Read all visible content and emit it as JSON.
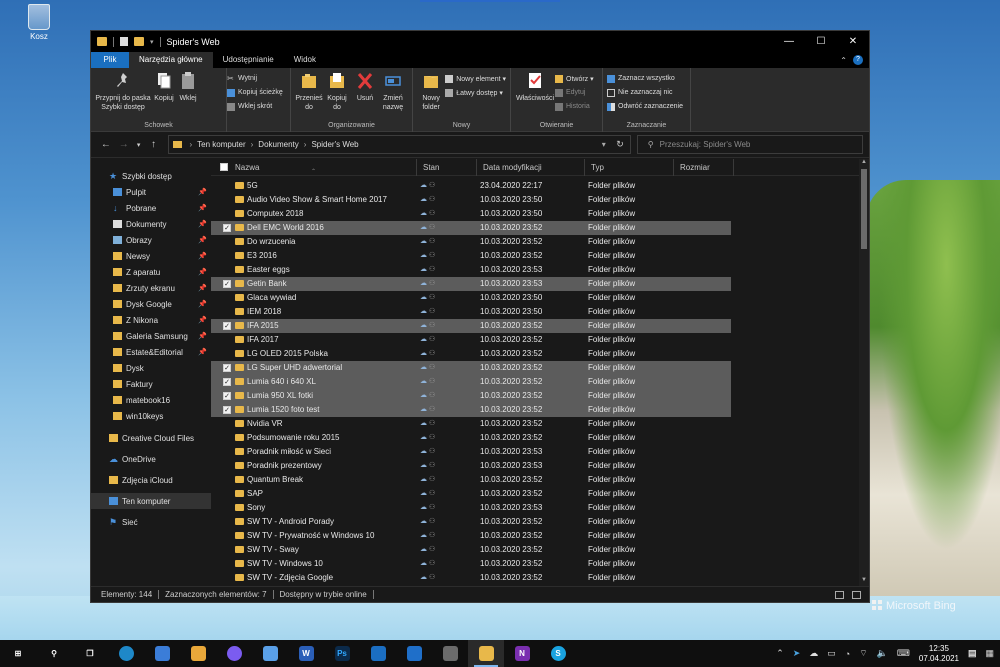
{
  "desktop": {
    "recycle_label": "Kosz",
    "watermark": "Microsoft Bing"
  },
  "window": {
    "title": "Spider's Web",
    "controls": {
      "minimize": "—",
      "maximize": "☐",
      "close": "✕"
    }
  },
  "ribbon": {
    "tabs": [
      "Plik",
      "Narzędzia główne",
      "Udostępnianie",
      "Widok"
    ],
    "groups": {
      "schowek": {
        "label": "Schowek",
        "pin_label": "Przypnij do paska Szybki dostęp",
        "copy_label": "Kopiuj",
        "paste_label": "Wklej",
        "cut_label": "Wytnij",
        "copy_path_label": "Kopiuj ścieżkę",
        "paste_shortcut_label": "Wklej skrót"
      },
      "organizowanie": {
        "label": "Organizowanie",
        "move_label": "Przenieś do",
        "copyto_label": "Kopiuj do",
        "delete_label": "Usuń",
        "rename_label": "Zmień nazwę"
      },
      "nowy": {
        "label": "Nowy",
        "new_folder_label": "Nowy folder",
        "new_item_label": "Nowy element ▾",
        "easy_access_label": "Łatwy dostęp ▾"
      },
      "otwieranie": {
        "label": "Otwieranie",
        "properties_label": "Właściwości",
        "open_label": "Otwórz ▾",
        "edit_label": "Edytuj",
        "history_label": "Historia"
      },
      "zaznaczanie": {
        "label": "Zaznaczanie",
        "select_all_label": "Zaznacz wszystko",
        "select_none_label": "Nie zaznaczaj nic",
        "invert_label": "Odwróć zaznaczenie"
      }
    }
  },
  "address": {
    "crumbs": [
      "Ten komputer",
      "Dokumenty",
      "Spider's Web"
    ],
    "search_placeholder": "Przeszukaj: Spider's Web"
  },
  "nav_pane": [
    {
      "label": "Szybki dostęp",
      "pinned": false
    },
    {
      "label": "Pulpit",
      "pinned": true
    },
    {
      "label": "Pobrane",
      "pinned": true
    },
    {
      "label": "Dokumenty",
      "pinned": true
    },
    {
      "label": "Obrazy",
      "pinned": true
    },
    {
      "label": "Newsy",
      "pinned": true
    },
    {
      "label": "Z aparatu",
      "pinned": true
    },
    {
      "label": "Zrzuty ekranu",
      "pinned": true
    },
    {
      "label": "Dysk Google",
      "pinned": true
    },
    {
      "label": "Z Nikona",
      "pinned": true
    },
    {
      "label": "Galeria Samsung",
      "pinned": true
    },
    {
      "label": "Estate&Editorial",
      "pinned": true
    },
    {
      "label": "Dysk",
      "pinned": false
    },
    {
      "label": "Faktury",
      "pinned": false
    },
    {
      "label": "matebook16",
      "pinned": false
    },
    {
      "label": "win10keys",
      "pinned": false
    },
    {
      "label": "Creative Cloud Files",
      "pinned": false
    },
    {
      "label": "OneDrive",
      "pinned": false
    },
    {
      "label": "Zdjęcia iCloud",
      "pinned": false
    },
    {
      "label": "Ten komputer",
      "pinned": false
    },
    {
      "label": "Sieć",
      "pinned": false
    }
  ],
  "columns": [
    "Nazwa",
    "Stan",
    "Data modyfikacji",
    "Typ",
    "Rozmiar"
  ],
  "files": [
    {
      "name": "5G",
      "date": "23.04.2020 22:17",
      "type": "Folder plików",
      "selected": false
    },
    {
      "name": "Audio Video Show & Smart Home 2017",
      "date": "10.03.2020 23:50",
      "type": "Folder plików",
      "selected": false
    },
    {
      "name": "Computex 2018",
      "date": "10.03.2020 23:50",
      "type": "Folder plików",
      "selected": false
    },
    {
      "name": "Dell EMC World 2016",
      "date": "10.03.2020 23:52",
      "type": "Folder plików",
      "selected": true
    },
    {
      "name": "Do wrzucenia",
      "date": "10.03.2020 23:52",
      "type": "Folder plików",
      "selected": false
    },
    {
      "name": "E3 2016",
      "date": "10.03.2020 23:52",
      "type": "Folder plików",
      "selected": false
    },
    {
      "name": "Easter eggs",
      "date": "10.03.2020 23:53",
      "type": "Folder plików",
      "selected": false
    },
    {
      "name": "Getin Bank",
      "date": "10.03.2020 23:53",
      "type": "Folder plików",
      "selected": true
    },
    {
      "name": "Glaca wywiad",
      "date": "10.03.2020 23:50",
      "type": "Folder plików",
      "selected": false
    },
    {
      "name": "IEM 2018",
      "date": "10.03.2020 23:50",
      "type": "Folder plików",
      "selected": false
    },
    {
      "name": "IFA 2015",
      "date": "10.03.2020 23:52",
      "type": "Folder plików",
      "selected": true
    },
    {
      "name": "IFA 2017",
      "date": "10.03.2020 23:52",
      "type": "Folder plików",
      "selected": false
    },
    {
      "name": "LG OLED 2015 Polska",
      "date": "10.03.2020 23:52",
      "type": "Folder plików",
      "selected": false
    },
    {
      "name": "LG Super UHD adwertorial",
      "date": "10.03.2020 23:52",
      "type": "Folder plików",
      "selected": true
    },
    {
      "name": "Lumia 640 i 640 XL",
      "date": "10.03.2020 23:52",
      "type": "Folder plików",
      "selected": true
    },
    {
      "name": "Lumia 950 XL fotki",
      "date": "10.03.2020 23:52",
      "type": "Folder plików",
      "selected": true
    },
    {
      "name": "Lumia 1520 foto test",
      "date": "10.03.2020 23:52",
      "type": "Folder plików",
      "selected": true
    },
    {
      "name": "Nvidia VR",
      "date": "10.03.2020 23:52",
      "type": "Folder plików",
      "selected": false
    },
    {
      "name": "Podsumowanie roku 2015",
      "date": "10.03.2020 23:52",
      "type": "Folder plików",
      "selected": false
    },
    {
      "name": "Poradnik miłość w Sieci",
      "date": "10.03.2020 23:53",
      "type": "Folder plików",
      "selected": false
    },
    {
      "name": "Poradnik prezentowy",
      "date": "10.03.2020 23:53",
      "type": "Folder plików",
      "selected": false
    },
    {
      "name": "Quantum Break",
      "date": "10.03.2020 23:52",
      "type": "Folder plików",
      "selected": false
    },
    {
      "name": "SAP",
      "date": "10.03.2020 23:52",
      "type": "Folder plików",
      "selected": false
    },
    {
      "name": "Sony",
      "date": "10.03.2020 23:53",
      "type": "Folder plików",
      "selected": false
    },
    {
      "name": "SW TV - Android Porady",
      "date": "10.03.2020 23:52",
      "type": "Folder plików",
      "selected": false
    },
    {
      "name": "SW TV - Prywatność w Windows 10",
      "date": "10.03.2020 23:52",
      "type": "Folder plików",
      "selected": false
    },
    {
      "name": "SW TV - Sway",
      "date": "10.03.2020 23:52",
      "type": "Folder plików",
      "selected": false
    },
    {
      "name": "SW TV - Windows 10",
      "date": "10.03.2020 23:52",
      "type": "Folder plików",
      "selected": false
    },
    {
      "name": "SW TV - Zdjęcia Google",
      "date": "10.03.2020 23:52",
      "type": "Folder plików",
      "selected": false
    }
  ],
  "status": {
    "count": "Elementy: 144",
    "selected": "Zaznaczonych elementów: 7",
    "availability": "Dostępny w trybie online"
  },
  "taskbar": {
    "time": "12:35",
    "date": "07.04.2021"
  },
  "colors": {
    "accent": "#1a6fc0",
    "folder": "#e8b84a",
    "selection": "#5c5c5c",
    "window_bg": "#191919"
  }
}
